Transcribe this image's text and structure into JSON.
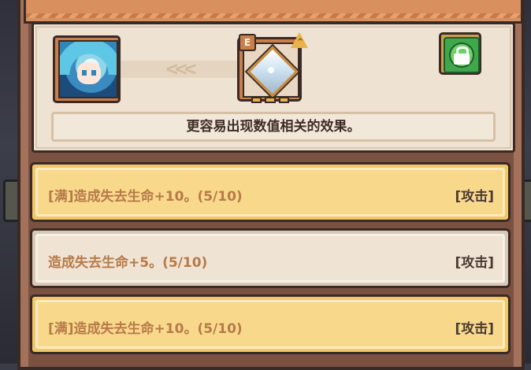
{
  "title": "",
  "description": "更容易出现数值相关的效果。",
  "stone": {
    "grade": "E",
    "tier_mark": "^"
  },
  "arrows": "<<<",
  "effects": [
    {
      "text": "[满]造成失去生命+10。(5/10)",
      "tag": "[攻击]",
      "style": "full"
    },
    {
      "text": "造成失去生命+5。(5/10)",
      "tag": "[攻击]",
      "style": "plain"
    },
    {
      "text": "[满]造成失去生命+10。(5/10)",
      "tag": "[攻击]",
      "style": "full"
    }
  ],
  "colors": {
    "panel_brown": "#a4715a",
    "title_orange": "#d98f5e",
    "full_row_gold": "#f0c86a",
    "plain_row_beige": "#d9c8b5",
    "lock_green": "#3fa84a"
  }
}
